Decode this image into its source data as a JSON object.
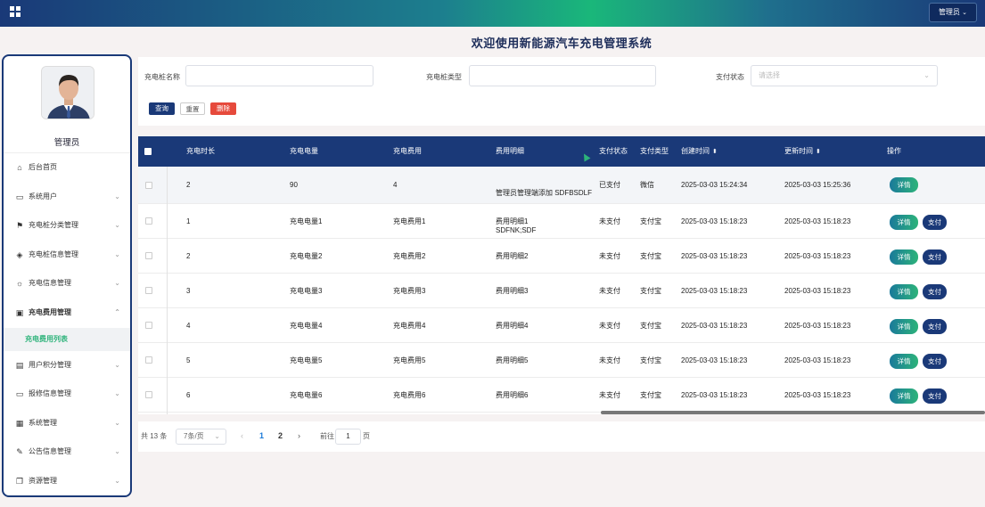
{
  "header": {
    "admin_label": "管理员",
    "admin_caret": "⌄"
  },
  "welcome": "欢迎使用新能源汽车充电管理系统",
  "sidebar": {
    "user_name": "管理员",
    "items": [
      {
        "label": "后台首页",
        "icon": "home-icon",
        "glyph": "⌂",
        "chev": ""
      },
      {
        "label": "系统用户",
        "icon": "monitor-icon",
        "glyph": "▭",
        "chev": "⌄"
      },
      {
        "label": "充电桩分类管理",
        "icon": "bookmark-icon",
        "glyph": "⚑",
        "chev": "⌄"
      },
      {
        "label": "充电桩信息管理",
        "icon": "tag-icon",
        "glyph": "◈",
        "chev": "⌄"
      },
      {
        "label": "充电信息管理",
        "icon": "sun-icon",
        "glyph": "☼",
        "chev": "⌄"
      },
      {
        "label": "充电费用管理",
        "icon": "inbox-icon",
        "glyph": "▣",
        "chev": "⌃"
      },
      {
        "label": "用户积分管理",
        "icon": "clipboard-icon",
        "glyph": "▤",
        "chev": "⌄"
      },
      {
        "label": "报修信息管理",
        "icon": "message-icon",
        "glyph": "▭",
        "chev": "⌄"
      },
      {
        "label": "系统管理",
        "icon": "window-icon",
        "glyph": "▦",
        "chev": "⌄"
      },
      {
        "label": "公告信息管理",
        "icon": "paperclip-icon",
        "glyph": "✎",
        "chev": "⌄"
      },
      {
        "label": "资源管理",
        "icon": "copy-icon",
        "glyph": "❐",
        "chev": "⌄"
      }
    ],
    "active_sub": "充电费用列表"
  },
  "filter": {
    "name_label": "充电桩名称",
    "type_label": "充电桩类型",
    "status_label": "支付状态",
    "status_placeholder": "请选择",
    "query": "查询",
    "reset": "重置",
    "delete": "删除"
  },
  "table": {
    "headers": {
      "duration": "充电时长",
      "amount": "充电电量",
      "fee": "充电费用",
      "detail": "费用明细",
      "pay_status": "支付状态",
      "pay_type": "支付类型",
      "created": "创建时间",
      "updated": "更新时间",
      "ops": "操作",
      "sort_glyph": "⬍"
    },
    "btn_detail": "详情",
    "btn_pay": "支付",
    "rows": [
      {
        "duration": "2",
        "amount": "90",
        "fee": "4",
        "detail": "管理员管理端添加 SDFBSDLF SDFNK;SDF",
        "pay_status": "已支付",
        "pay_type": "微信",
        "created": "2025-03-03 15:24:34",
        "updated": "2025-03-03 15:25:36"
      },
      {
        "duration": "1",
        "amount": "充电电量1",
        "fee": "充电费用1",
        "detail": "费用明细1",
        "pay_status": "未支付",
        "pay_type": "支付宝",
        "created": "2025-03-03 15:18:23",
        "updated": "2025-03-03 15:18:23"
      },
      {
        "duration": "2",
        "amount": "充电电量2",
        "fee": "充电费用2",
        "detail": "费用明细2",
        "pay_status": "未支付",
        "pay_type": "支付宝",
        "created": "2025-03-03 15:18:23",
        "updated": "2025-03-03 15:18:23"
      },
      {
        "duration": "3",
        "amount": "充电电量3",
        "fee": "充电费用3",
        "detail": "费用明细3",
        "pay_status": "未支付",
        "pay_type": "支付宝",
        "created": "2025-03-03 15:18:23",
        "updated": "2025-03-03 15:18:23"
      },
      {
        "duration": "4",
        "amount": "充电电量4",
        "fee": "充电费用4",
        "detail": "费用明细4",
        "pay_status": "未支付",
        "pay_type": "支付宝",
        "created": "2025-03-03 15:18:23",
        "updated": "2025-03-03 15:18:23"
      },
      {
        "duration": "5",
        "amount": "充电电量5",
        "fee": "充电费用5",
        "detail": "费用明细5",
        "pay_status": "未支付",
        "pay_type": "支付宝",
        "created": "2025-03-03 15:18:23",
        "updated": "2025-03-03 15:18:23"
      },
      {
        "duration": "6",
        "amount": "充电电量6",
        "fee": "充电费用6",
        "detail": "费用明细6",
        "pay_status": "未支付",
        "pay_type": "支付宝",
        "created": "2025-03-03 15:18:23",
        "updated": "2025-03-03 15:18:23"
      }
    ]
  },
  "pager": {
    "total": "共 13 条",
    "page_size": "7条/页",
    "prev": "‹",
    "page1": "1",
    "page2": "2",
    "next": "›",
    "goto_label": "前往",
    "goto_value": "1",
    "goto_suffix": "页"
  },
  "colors": {
    "primary": "#1a3978",
    "accent": "#2db37a",
    "danger": "#e64a3c"
  }
}
